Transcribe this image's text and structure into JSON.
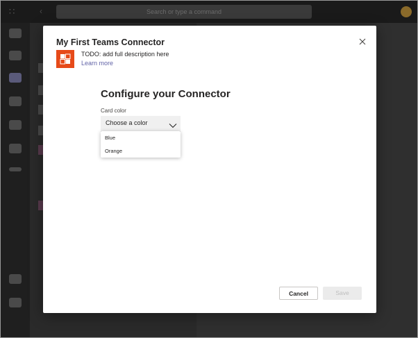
{
  "background": {
    "search_placeholder": "Search or type a command"
  },
  "dialog": {
    "title": "My First Teams Connector",
    "description": "TODO: add full description here",
    "learn_more": "Learn more",
    "configure_title": "Configure your Connector",
    "card_color_label": "Card color",
    "dropdown_placeholder": "Choose a color",
    "options": [
      {
        "label": "Blue"
      },
      {
        "label": "Orange"
      }
    ],
    "cancel_label": "Cancel",
    "save_label": "Save"
  },
  "colors": {
    "app_icon": "#e64a19",
    "link": "#6264a7"
  }
}
